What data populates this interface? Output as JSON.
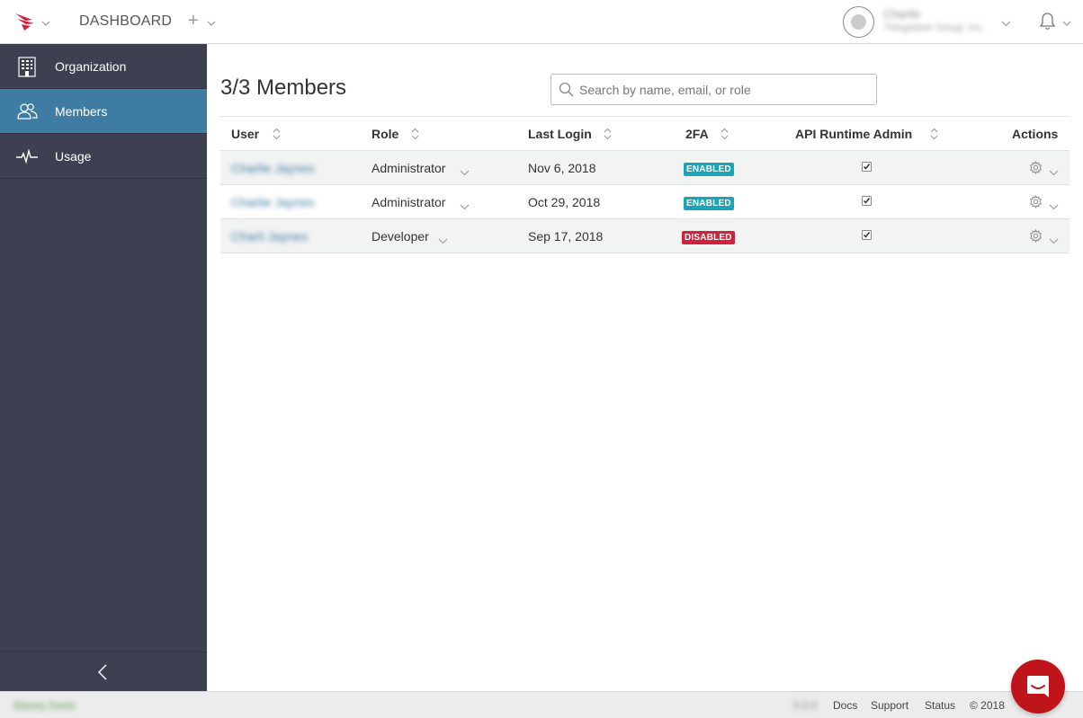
{
  "header": {
    "title": "DASHBOARD",
    "user_name": "Charlie",
    "user_org": "Thingsdoer Group, Inc."
  },
  "sidebar": {
    "items": [
      {
        "label": "Organization",
        "icon": "building-icon",
        "active": false
      },
      {
        "label": "Members",
        "icon": "people-icon",
        "active": true
      },
      {
        "label": "Usage",
        "icon": "pulse-icon",
        "active": false
      }
    ]
  },
  "main": {
    "title": "3/3 Members",
    "search_placeholder": "Search by name, email, or role"
  },
  "table": {
    "columns": [
      "User",
      "Role",
      "Last Login",
      "2FA",
      "API Runtime Admin",
      "Actions"
    ],
    "rows": [
      {
        "user": "Charlie Jaynes",
        "role": "Administrator",
        "last_login": "Nov 6, 2018",
        "twofa": "ENABLED",
        "api_admin": true
      },
      {
        "user": "Charlie Jaynes",
        "role": "Administrator",
        "last_login": "Oct 29, 2018",
        "twofa": "ENABLED",
        "api_admin": true
      },
      {
        "user": "Charli Jaynes",
        "role": "Developer",
        "last_login": "Sep 17, 2018",
        "twofa": "DISABLED",
        "api_admin": true
      }
    ]
  },
  "footer": {
    "left_text": "Stacey Davis",
    "version": "5.0.0",
    "links": [
      "Docs",
      "Support",
      "Status"
    ],
    "copyright": "© 2018"
  },
  "colors": {
    "sidebar_bg": "#3c4051",
    "active_item": "#3f7ca3",
    "enabled_badge": "#1ba3b8",
    "disabled_badge": "#d0223a",
    "chat_button": "#c0141b",
    "brand": "#d0223a"
  }
}
